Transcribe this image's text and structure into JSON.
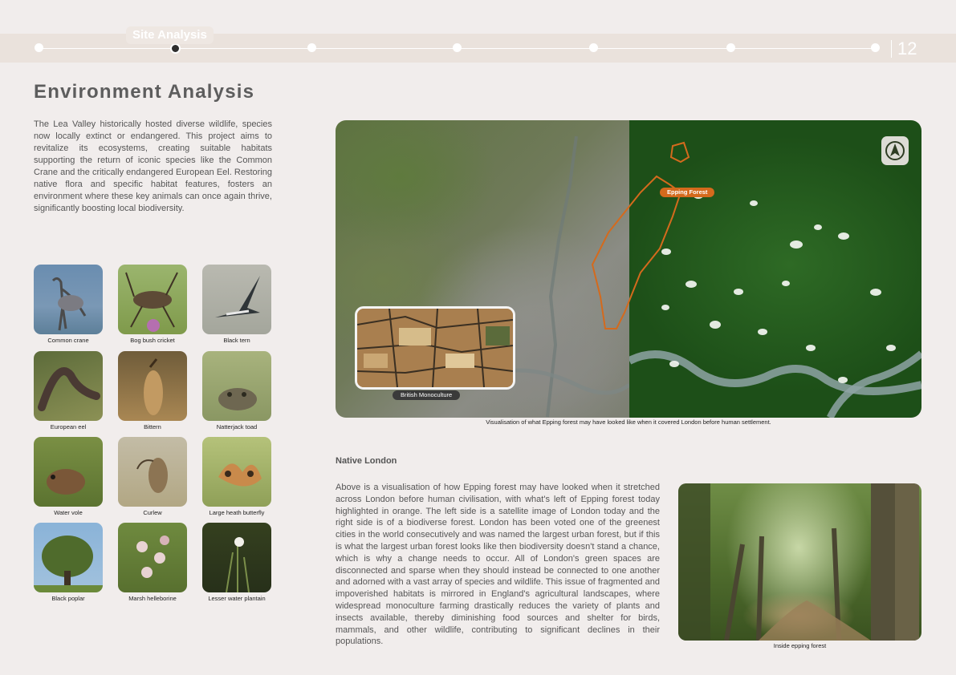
{
  "header": {
    "section_label": "Site Analysis",
    "page_number": "12"
  },
  "title": "Environment Analysis",
  "intro": "The Lea Valley historically hosted diverse wildlife, species now locally extinct or endangered. This project aims to revitalize its ecosystems, creating suitable habitats supporting the return of iconic species like the Common Crane and the critically endangered European Eel. Restoring native flora and specific habitat features, fosters an environment where these key animals can once again thrive, significantly boosting local biodiversity.",
  "species": [
    {
      "name": "Common crane"
    },
    {
      "name": "Bog bush cricket"
    },
    {
      "name": "Black tern"
    },
    {
      "name": "European eel"
    },
    {
      "name": "Bittern"
    },
    {
      "name": "Natterjack toad"
    },
    {
      "name": "Water vole"
    },
    {
      "name": "Curlew"
    },
    {
      "name": "Large heath butterfly"
    },
    {
      "name": "Black poplar"
    },
    {
      "name": "Marsh helleborine"
    },
    {
      "name": "Lesser water plantain"
    }
  ],
  "map": {
    "forest_label": "Epping Forest",
    "inset_label": "British Monoculture",
    "compass_icon": "north-arrow-icon",
    "caption": "Visualisation of what Epping forest may have looked like when it covered London before human settlement."
  },
  "native_london": {
    "heading": "Native London",
    "body": "Above is a visualisation of how Epping forest may have looked when it stretched across London before human civilisation, with what's left of Epping forest today highlighted in orange. The left side is a satellite image of London today and the right side is of a biodiverse forest. London has been voted one of the greenest cities in the world consecutively and was named the largest urban forest, but if this is what the largest urban forest looks like then biodiversity doesn't stand a chance, which is why a change needs to occur. All of London's green spaces are disconnected and sparse when they should instead be connected to one another and adorned with a vast array of species and wildlife. This issue of fragmented and impoverished habitats is mirrored in England's agricultural landscapes, where widespread monoculture farming drastically reduces the variety of plants and insects available, thereby diminishing food sources and shelter for birds, mammals, and other wildlife, contributing to significant declines in their populations."
  },
  "photo": {
    "caption": "Inside epping forest"
  },
  "colors": {
    "accent_orange": "#d46a1d",
    "background": "#f1edec",
    "band": "#eae2dc"
  }
}
